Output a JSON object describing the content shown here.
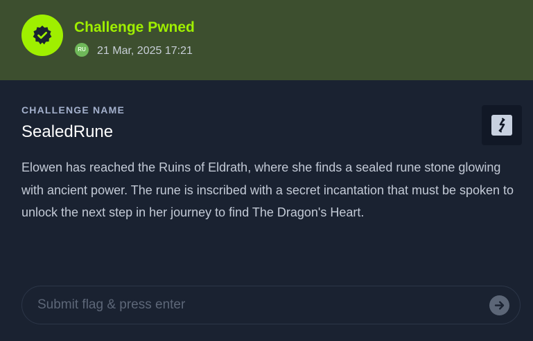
{
  "banner": {
    "title": "Challenge Pwned",
    "avatar_initials": "RU",
    "date": "21 Mar, 2025 17:21",
    "badge_icon": "shield-check-icon"
  },
  "challenge": {
    "section_label": "CHALLENGE NAME",
    "name": "SealedRune",
    "description": "Elowen has reached the Ruins of Eldrath, where she finds a sealed rune stone glowing with ancient power. The rune is inscribed with a secret incantation that must be spoken to unlock the next step in her journey to find The Dragon's Heart.",
    "swap_icon": "swap-icon"
  },
  "flag_form": {
    "placeholder": "Submit flag & press enter",
    "value": "",
    "submit_icon": "arrow-right-icon"
  },
  "colors": {
    "accent": "#9fef00",
    "banner_bg": "#3d4f2f",
    "page_bg": "#1a2231"
  }
}
